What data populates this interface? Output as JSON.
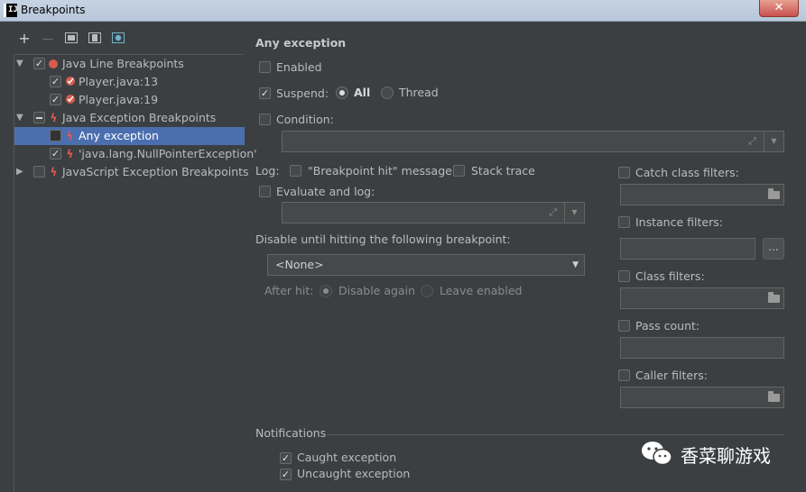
{
  "window": {
    "title": "Breakpoints",
    "logo_text": "IJ",
    "close_label": "✕"
  },
  "toolbar": {
    "add": "+",
    "remove": "—"
  },
  "tree": {
    "items": [
      {
        "label": "Java Line Breakpoints",
        "checked": true,
        "icon": "red-dot-icon",
        "expanded": true
      },
      {
        "label": "Player.java:13",
        "checked": true,
        "icon": "line-breakpoint-icon"
      },
      {
        "label": "Player.java:19",
        "checked": true,
        "icon": "line-breakpoint-icon"
      },
      {
        "label": "Java Exception Breakpoints",
        "checked": "partial",
        "icon": "exception-bolt-icon",
        "expanded": true
      },
      {
        "label": "Any exception",
        "checked": false,
        "icon": "exception-bolt-icon",
        "selected": true
      },
      {
        "label": "'java.lang.NullPointerException'",
        "checked": true,
        "icon": "exception-bolt-icon"
      },
      {
        "label": "JavaScript Exception Breakpoints",
        "checked": false,
        "icon": "exception-bolt-icon",
        "expanded": false
      }
    ]
  },
  "details": {
    "heading": "Any exception",
    "enabled_label": "Enabled",
    "suspend_label": "Suspend:",
    "suspend_all": "All",
    "suspend_thread": "Thread",
    "condition_label": "Condition:",
    "log_label": "Log:",
    "log_message": "\"Breakpoint hit\" message",
    "stack_trace": "Stack trace",
    "evaluate_label": "Evaluate and log:",
    "disable_until_label": "Disable until hitting the following breakpoint:",
    "disable_until_value": "<None>",
    "after_hit_label": "After hit:",
    "disable_again": "Disable again",
    "leave_enabled": "Leave enabled",
    "catch_filters": "Catch class filters:",
    "instance_filters": "Instance filters:",
    "instance_browse": "...",
    "class_filters": "Class filters:",
    "pass_count": "Pass count:",
    "caller_filters": "Caller filters:",
    "notifications_label": "Notifications",
    "caught_exception": "Caught exception",
    "uncaught_exception": "Uncaught exception"
  },
  "watermark": {
    "text": "香菜聊游戏"
  },
  "colors": {
    "panel_bg": "#3c3f41",
    "selection": "#4b6eaf",
    "breakpoint_red": "#d95b4e"
  }
}
